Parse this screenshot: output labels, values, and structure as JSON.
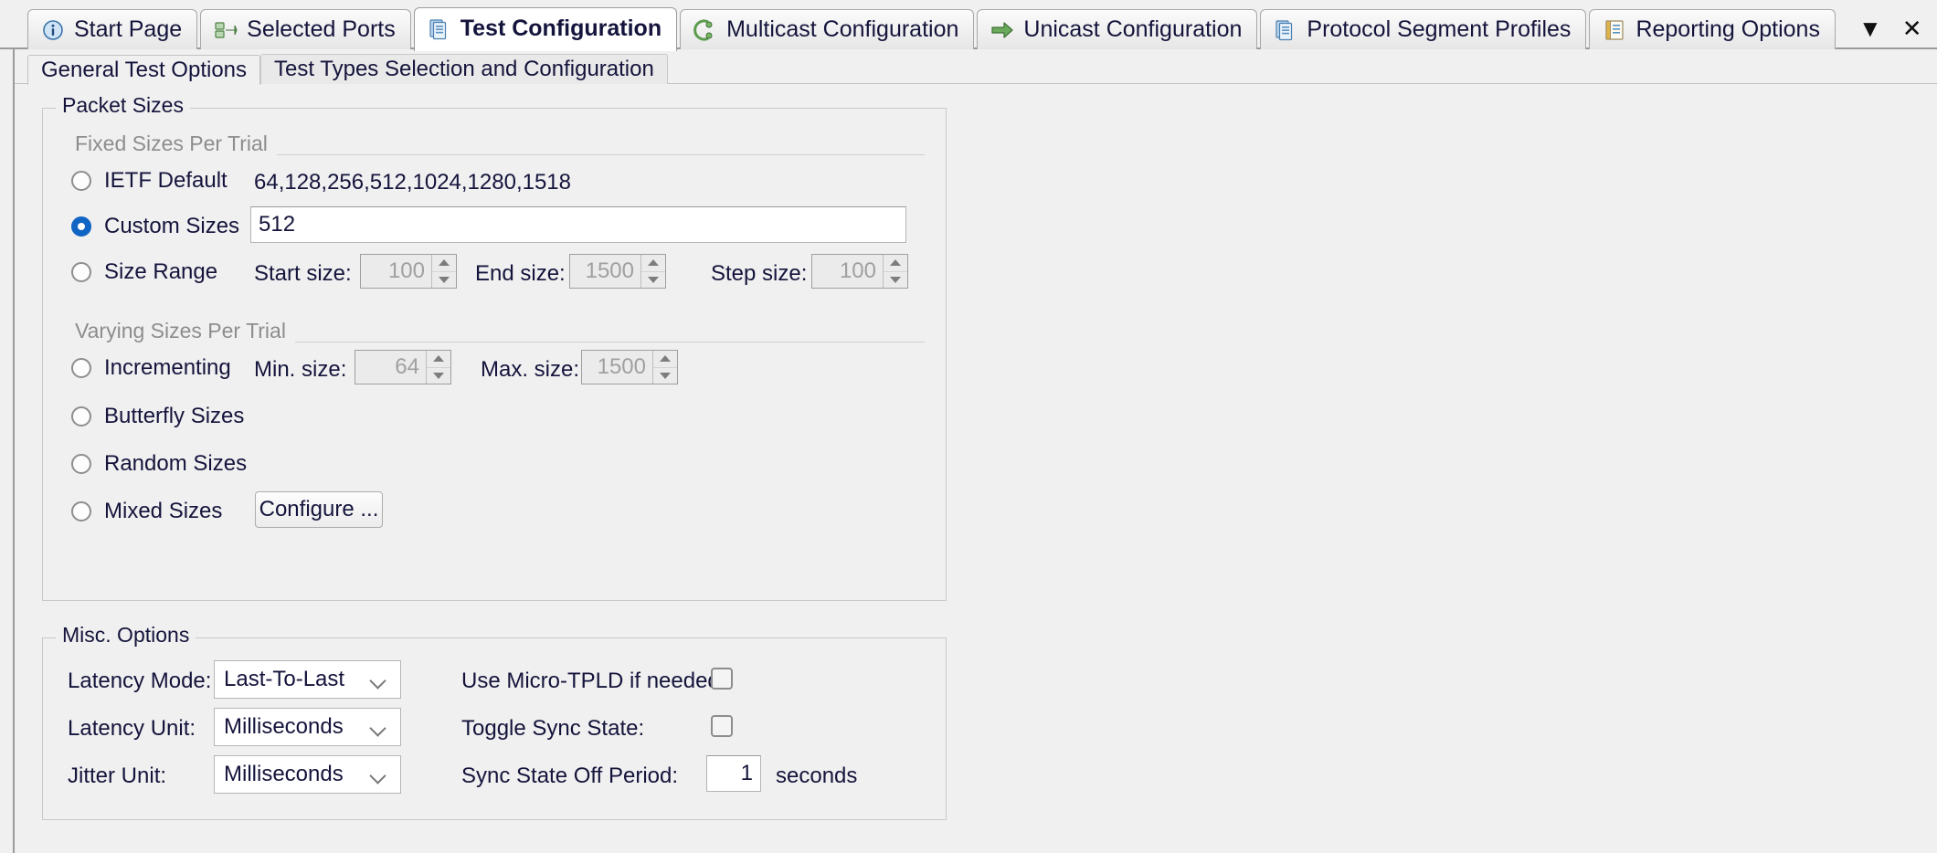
{
  "window": {
    "tabs": [
      {
        "label": "Start Page",
        "icon": "info-circle-icon",
        "active": false
      },
      {
        "label": "Selected Ports",
        "icon": "ports-icon",
        "active": false
      },
      {
        "label": "Test Configuration",
        "icon": "documents-icon",
        "active": true
      },
      {
        "label": "Multicast Configuration",
        "icon": "multicast-icon",
        "active": false
      },
      {
        "label": "Unicast Configuration",
        "icon": "arrow-right-icon",
        "active": false
      },
      {
        "label": "Protocol Segment Profiles",
        "icon": "documents-icon",
        "active": false
      },
      {
        "label": "Reporting Options",
        "icon": "notebook-icon",
        "active": false
      }
    ],
    "overflow_label": "▼",
    "close_label": "✕"
  },
  "subtabs": [
    {
      "label": "General Test Options",
      "active": true
    },
    {
      "label": "Test Types Selection and Configuration",
      "active": false
    }
  ],
  "packet_sizes": {
    "title": "Packet Sizes",
    "fixed_section_label": "Fixed Sizes Per Trial",
    "varying_section_label": "Varying Sizes Per Trial",
    "ietf_default": {
      "label": "IETF Default",
      "checked": false,
      "value": "64,128,256,512,1024,1280,1518"
    },
    "custom_sizes": {
      "label": "Custom Sizes",
      "checked": true,
      "value": "512"
    },
    "size_range": {
      "label": "Size Range",
      "checked": false,
      "start_label": "Start size:",
      "start_value": "100",
      "end_label": "End size:",
      "end_value": "1500",
      "step_label": "Step size:",
      "step_value": "100"
    },
    "incrementing": {
      "label": "Incrementing",
      "checked": false,
      "min_label": "Min. size:",
      "min_value": "64",
      "max_label": "Max. size:",
      "max_value": "1500"
    },
    "butterfly_sizes": {
      "label": "Butterfly Sizes",
      "checked": false
    },
    "random_sizes": {
      "label": "Random Sizes",
      "checked": false
    },
    "mixed_sizes": {
      "label": "Mixed Sizes",
      "checked": false,
      "configure_button": "Configure ..."
    }
  },
  "misc_options": {
    "title": "Misc. Options",
    "latency_mode": {
      "label": "Latency Mode:",
      "value": "Last-To-Last"
    },
    "latency_unit": {
      "label": "Latency Unit:",
      "value": "Milliseconds"
    },
    "jitter_unit": {
      "label": "Jitter Unit:",
      "value": "Milliseconds"
    },
    "micro_tpld": {
      "label": "Use Micro-TPLD if needed:",
      "checked": false
    },
    "toggle_sync_state": {
      "label": "Toggle Sync State:",
      "checked": false
    },
    "sync_state_off_period": {
      "label": "Sync State Off Period:",
      "value": "1",
      "unit": "seconds"
    }
  },
  "colors": {
    "accent": "#1064c4",
    "window_bg": "#f0f0f0",
    "text": "#14143c",
    "muted": "#8d8d8d",
    "disabled_text": "#a0a0a0"
  }
}
